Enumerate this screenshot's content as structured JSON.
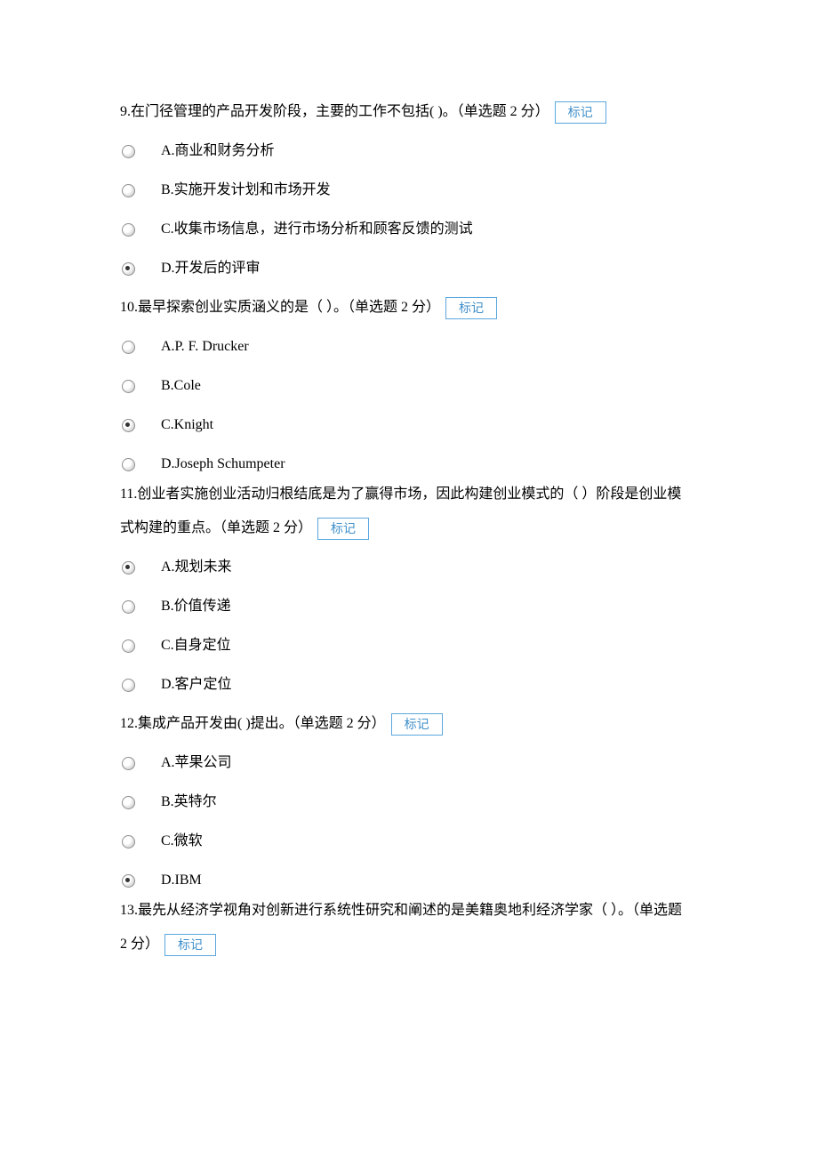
{
  "mark_label": "标记",
  "questions": [
    {
      "id": "q9",
      "text": "9.在门径管理的产品开发阶段，主要的工作不包括( )。（单选题 2 分）",
      "selected": 3,
      "options": [
        "A.商业和财务分析",
        "B.实施开发计划和市场开发",
        "C.收集市场信息，进行市场分析和顾客反馈的测试",
        "D.开发后的评审"
      ]
    },
    {
      "id": "q10",
      "text": "10.最早探索创业实质涵义的是（ ）。（单选题 2 分）",
      "selected": 2,
      "options": [
        "A.P. F. Drucker",
        "B.Cole",
        "C.Knight",
        "D.Joseph Schumpeter"
      ]
    },
    {
      "id": "q11",
      "text_part1": "11.创业者实施创业活动归根结底是为了赢得市场，因此构建创业模式的（ ）阶段是创业模",
      "text_part2": "式构建的重点。（单选题 2 分）",
      "selected": 0,
      "options": [
        "A.规划未来",
        "B.价值传递",
        "C.自身定位",
        "D.客户定位"
      ]
    },
    {
      "id": "q12",
      "text": "12.集成产品开发由( )提出。（单选题 2 分）",
      "selected": 3,
      "options": [
        "A.苹果公司",
        "B.英特尔",
        "C.微软",
        "D.IBM"
      ]
    },
    {
      "id": "q13",
      "text_part1": "13.最先从经济学视角对创新进行系统性研究和阐述的是美籍奥地利经济学家（ ）。（单选题",
      "text_part2": "2 分）"
    }
  ]
}
